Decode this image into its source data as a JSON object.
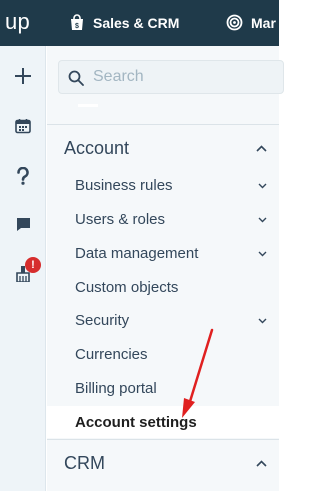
{
  "topbar": {
    "logo": "up",
    "nav": [
      {
        "label": "Sales & CRM",
        "icon": "shopping-bag-icon"
      },
      {
        "label": "Mar",
        "icon": "target-icon"
      }
    ]
  },
  "rail": {
    "items": [
      {
        "icon": "plus-icon"
      },
      {
        "icon": "calendar-icon"
      },
      {
        "icon": "help-icon"
      },
      {
        "icon": "chat-icon"
      },
      {
        "icon": "broom-icon",
        "badge": "!"
      }
    ]
  },
  "search": {
    "placeholder": "Search"
  },
  "sections": [
    {
      "title": "Account",
      "expanded": true,
      "items": [
        {
          "label": "Business rules",
          "has_children": true
        },
        {
          "label": "Users & roles",
          "has_children": true
        },
        {
          "label": "Data management",
          "has_children": true
        },
        {
          "label": "Custom objects",
          "has_children": false
        },
        {
          "label": "Security",
          "has_children": true
        },
        {
          "label": "Currencies",
          "has_children": false
        },
        {
          "label": "Billing portal",
          "has_children": false
        },
        {
          "label": "Account settings",
          "has_children": false,
          "active": true
        }
      ]
    },
    {
      "title": "CRM",
      "expanded": true,
      "items": []
    }
  ],
  "colors": {
    "topbar": "#1f3a4a",
    "rail": "#eef4f8",
    "panel": "#f5f8fa",
    "text": "#33475b",
    "badge": "#d62d2d",
    "arrow": "#e02020"
  }
}
